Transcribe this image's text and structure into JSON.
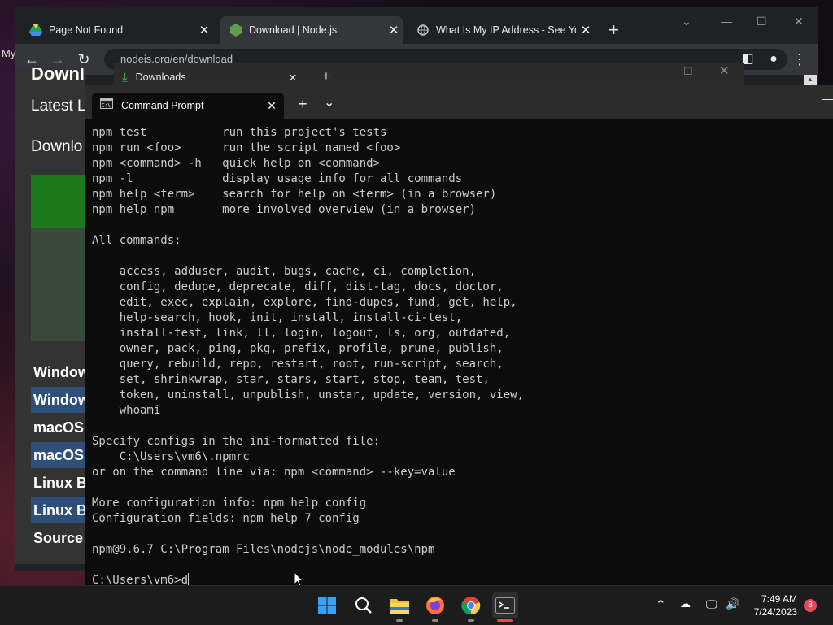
{
  "browser": {
    "tabs": [
      {
        "title": "Page Not Found",
        "icon": "google-drive-icon",
        "close": "✕"
      },
      {
        "title": "Download | Node.js",
        "icon": "nodejs-icon",
        "close": "✕"
      },
      {
        "title": "What Is My IP Address - See You",
        "icon": "globe-icon",
        "close": "✕"
      }
    ],
    "new_tab": "+",
    "url": "nodejs.org/en/download",
    "side_text": "My"
  },
  "page_behind": {
    "headings": [
      "Downlo",
      "Latest LT",
      "Downlo"
    ],
    "rows": [
      "Window",
      "Window",
      "macOS",
      "macOS",
      "Linux B",
      "Linux B",
      "Source"
    ]
  },
  "downloads": {
    "title": "Downloads",
    "close": "✕",
    "new_tab": "+"
  },
  "cmd": {
    "tab_title": "Command Prompt",
    "close": "✕",
    "new_tab": "+",
    "dropdown": "⌄",
    "lines": [
      "npm test           run this project's tests",
      "npm run <foo>      run the script named <foo>",
      "npm <command> -h   quick help on <command>",
      "npm -l             display usage info for all commands",
      "npm help <term>    search for help on <term> (in a browser)",
      "npm help npm       more involved overview (in a browser)",
      "",
      "All commands:",
      "",
      "    access, adduser, audit, bugs, cache, ci, completion,",
      "    config, dedupe, deprecate, diff, dist-tag, docs, doctor,",
      "    edit, exec, explain, explore, find-dupes, fund, get, help,",
      "    help-search, hook, init, install, install-ci-test,",
      "    install-test, link, ll, login, logout, ls, org, outdated,",
      "    owner, pack, ping, pkg, prefix, profile, prune, publish,",
      "    query, rebuild, repo, restart, root, run-script, search,",
      "    set, shrinkwrap, star, stars, start, stop, team, test,",
      "    token, uninstall, unpublish, unstar, update, version, view,",
      "    whoami",
      "",
      "Specify configs in the ini-formatted file:",
      "    C:\\Users\\vm6\\.npmrc",
      "or on the command line via: npm <command> --key=value",
      "",
      "More configuration info: npm help config",
      "Configuration fields: npm help 7 config",
      "",
      "npm@9.6.7 C:\\Program Files\\nodejs\\node_modules\\npm",
      ""
    ],
    "prompt": "C:\\Users\\vm6>d"
  },
  "taskbar": {
    "apps": [
      {
        "name": "start-button",
        "icon": "windows-icon"
      },
      {
        "name": "search-button",
        "icon": "search-icon"
      },
      {
        "name": "file-explorer-button",
        "icon": "folder-icon"
      },
      {
        "name": "firefox-button",
        "icon": "firefox-icon"
      },
      {
        "name": "chrome-button",
        "icon": "chrome-icon"
      },
      {
        "name": "terminal-button",
        "icon": "terminal-icon"
      }
    ],
    "time": "7:49 AM",
    "date": "7/24/2023",
    "notifications": "3"
  },
  "colors": {
    "terminal_bg": "#0c0c0c",
    "terminal_fg": "#cccccc",
    "chrome_bg": "#202124",
    "taskbar_bg": "#1c1c1c"
  }
}
